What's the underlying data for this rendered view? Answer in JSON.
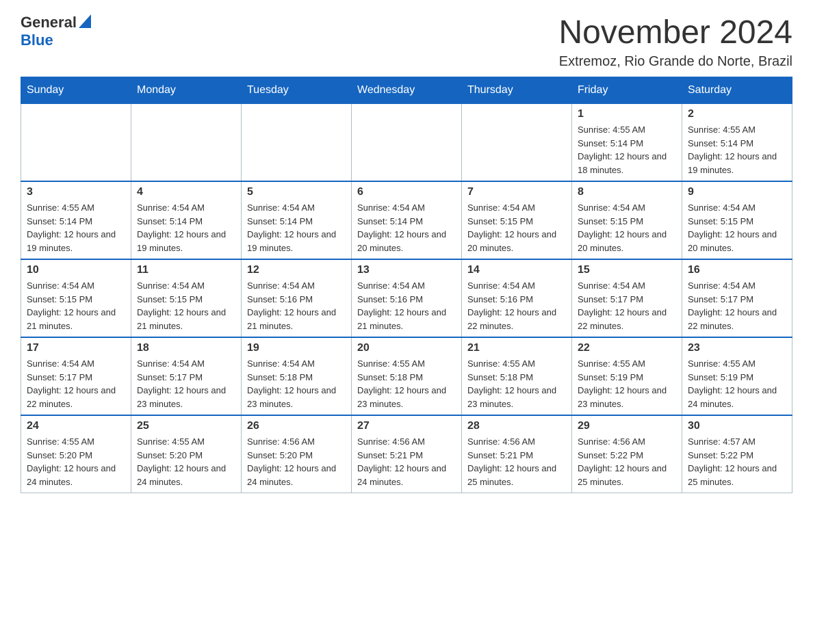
{
  "logo": {
    "general": "General",
    "blue": "Blue"
  },
  "title": "November 2024",
  "location": "Extremoz, Rio Grande do Norte, Brazil",
  "days": [
    "Sunday",
    "Monday",
    "Tuesday",
    "Wednesday",
    "Thursday",
    "Friday",
    "Saturday"
  ],
  "weeks": [
    [
      {
        "date": "",
        "sunrise": "",
        "sunset": "",
        "daylight": ""
      },
      {
        "date": "",
        "sunrise": "",
        "sunset": "",
        "daylight": ""
      },
      {
        "date": "",
        "sunrise": "",
        "sunset": "",
        "daylight": ""
      },
      {
        "date": "",
        "sunrise": "",
        "sunset": "",
        "daylight": ""
      },
      {
        "date": "",
        "sunrise": "",
        "sunset": "",
        "daylight": ""
      },
      {
        "date": "1",
        "sunrise": "Sunrise: 4:55 AM",
        "sunset": "Sunset: 5:14 PM",
        "daylight": "Daylight: 12 hours and 18 minutes."
      },
      {
        "date": "2",
        "sunrise": "Sunrise: 4:55 AM",
        "sunset": "Sunset: 5:14 PM",
        "daylight": "Daylight: 12 hours and 19 minutes."
      }
    ],
    [
      {
        "date": "3",
        "sunrise": "Sunrise: 4:55 AM",
        "sunset": "Sunset: 5:14 PM",
        "daylight": "Daylight: 12 hours and 19 minutes."
      },
      {
        "date": "4",
        "sunrise": "Sunrise: 4:54 AM",
        "sunset": "Sunset: 5:14 PM",
        "daylight": "Daylight: 12 hours and 19 minutes."
      },
      {
        "date": "5",
        "sunrise": "Sunrise: 4:54 AM",
        "sunset": "Sunset: 5:14 PM",
        "daylight": "Daylight: 12 hours and 19 minutes."
      },
      {
        "date": "6",
        "sunrise": "Sunrise: 4:54 AM",
        "sunset": "Sunset: 5:14 PM",
        "daylight": "Daylight: 12 hours and 20 minutes."
      },
      {
        "date": "7",
        "sunrise": "Sunrise: 4:54 AM",
        "sunset": "Sunset: 5:15 PM",
        "daylight": "Daylight: 12 hours and 20 minutes."
      },
      {
        "date": "8",
        "sunrise": "Sunrise: 4:54 AM",
        "sunset": "Sunset: 5:15 PM",
        "daylight": "Daylight: 12 hours and 20 minutes."
      },
      {
        "date": "9",
        "sunrise": "Sunrise: 4:54 AM",
        "sunset": "Sunset: 5:15 PM",
        "daylight": "Daylight: 12 hours and 20 minutes."
      }
    ],
    [
      {
        "date": "10",
        "sunrise": "Sunrise: 4:54 AM",
        "sunset": "Sunset: 5:15 PM",
        "daylight": "Daylight: 12 hours and 21 minutes."
      },
      {
        "date": "11",
        "sunrise": "Sunrise: 4:54 AM",
        "sunset": "Sunset: 5:15 PM",
        "daylight": "Daylight: 12 hours and 21 minutes."
      },
      {
        "date": "12",
        "sunrise": "Sunrise: 4:54 AM",
        "sunset": "Sunset: 5:16 PM",
        "daylight": "Daylight: 12 hours and 21 minutes."
      },
      {
        "date": "13",
        "sunrise": "Sunrise: 4:54 AM",
        "sunset": "Sunset: 5:16 PM",
        "daylight": "Daylight: 12 hours and 21 minutes."
      },
      {
        "date": "14",
        "sunrise": "Sunrise: 4:54 AM",
        "sunset": "Sunset: 5:16 PM",
        "daylight": "Daylight: 12 hours and 22 minutes."
      },
      {
        "date": "15",
        "sunrise": "Sunrise: 4:54 AM",
        "sunset": "Sunset: 5:17 PM",
        "daylight": "Daylight: 12 hours and 22 minutes."
      },
      {
        "date": "16",
        "sunrise": "Sunrise: 4:54 AM",
        "sunset": "Sunset: 5:17 PM",
        "daylight": "Daylight: 12 hours and 22 minutes."
      }
    ],
    [
      {
        "date": "17",
        "sunrise": "Sunrise: 4:54 AM",
        "sunset": "Sunset: 5:17 PM",
        "daylight": "Daylight: 12 hours and 22 minutes."
      },
      {
        "date": "18",
        "sunrise": "Sunrise: 4:54 AM",
        "sunset": "Sunset: 5:17 PM",
        "daylight": "Daylight: 12 hours and 23 minutes."
      },
      {
        "date": "19",
        "sunrise": "Sunrise: 4:54 AM",
        "sunset": "Sunset: 5:18 PM",
        "daylight": "Daylight: 12 hours and 23 minutes."
      },
      {
        "date": "20",
        "sunrise": "Sunrise: 4:55 AM",
        "sunset": "Sunset: 5:18 PM",
        "daylight": "Daylight: 12 hours and 23 minutes."
      },
      {
        "date": "21",
        "sunrise": "Sunrise: 4:55 AM",
        "sunset": "Sunset: 5:18 PM",
        "daylight": "Daylight: 12 hours and 23 minutes."
      },
      {
        "date": "22",
        "sunrise": "Sunrise: 4:55 AM",
        "sunset": "Sunset: 5:19 PM",
        "daylight": "Daylight: 12 hours and 23 minutes."
      },
      {
        "date": "23",
        "sunrise": "Sunrise: 4:55 AM",
        "sunset": "Sunset: 5:19 PM",
        "daylight": "Daylight: 12 hours and 24 minutes."
      }
    ],
    [
      {
        "date": "24",
        "sunrise": "Sunrise: 4:55 AM",
        "sunset": "Sunset: 5:20 PM",
        "daylight": "Daylight: 12 hours and 24 minutes."
      },
      {
        "date": "25",
        "sunrise": "Sunrise: 4:55 AM",
        "sunset": "Sunset: 5:20 PM",
        "daylight": "Daylight: 12 hours and 24 minutes."
      },
      {
        "date": "26",
        "sunrise": "Sunrise: 4:56 AM",
        "sunset": "Sunset: 5:20 PM",
        "daylight": "Daylight: 12 hours and 24 minutes."
      },
      {
        "date": "27",
        "sunrise": "Sunrise: 4:56 AM",
        "sunset": "Sunset: 5:21 PM",
        "daylight": "Daylight: 12 hours and 24 minutes."
      },
      {
        "date": "28",
        "sunrise": "Sunrise: 4:56 AM",
        "sunset": "Sunset: 5:21 PM",
        "daylight": "Daylight: 12 hours and 25 minutes."
      },
      {
        "date": "29",
        "sunrise": "Sunrise: 4:56 AM",
        "sunset": "Sunset: 5:22 PM",
        "daylight": "Daylight: 12 hours and 25 minutes."
      },
      {
        "date": "30",
        "sunrise": "Sunrise: 4:57 AM",
        "sunset": "Sunset: 5:22 PM",
        "daylight": "Daylight: 12 hours and 25 minutes."
      }
    ]
  ]
}
